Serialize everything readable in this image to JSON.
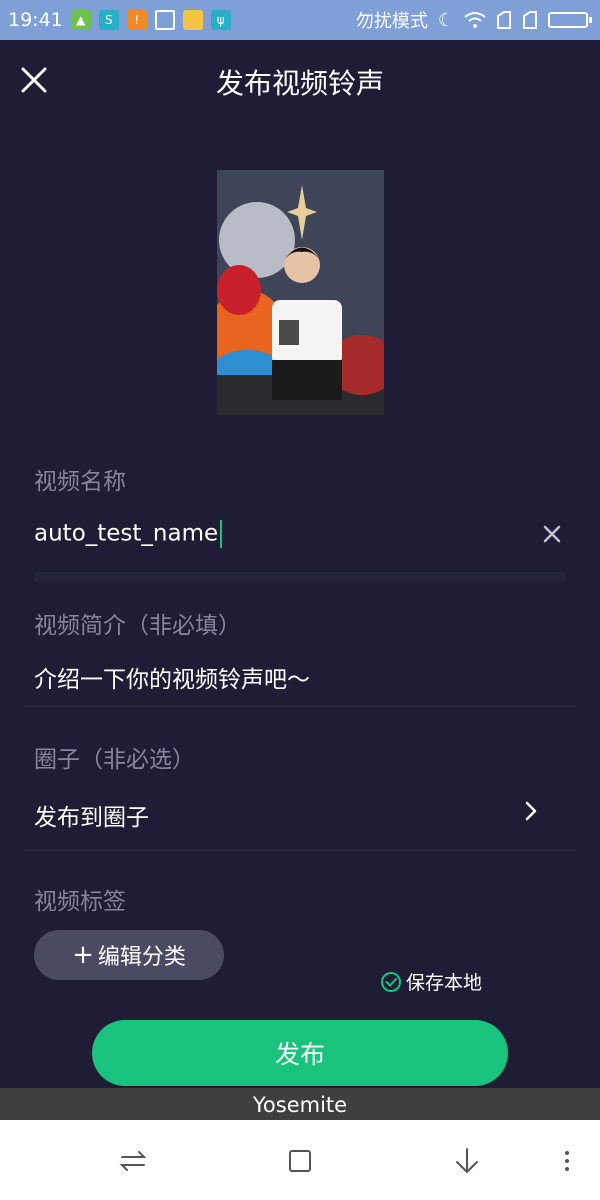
{
  "status_bar": {
    "time": "19:41",
    "right_text": "勿扰模式",
    "icons": [
      "android-icon",
      "app-icon",
      "warning-icon",
      "cleaner-icon",
      "folder-icon",
      "usb-icon",
      "moon-icon",
      "wifi-icon",
      "signal-icon",
      "signal-icon",
      "battery-icon"
    ]
  },
  "header": {
    "title": "发布视频铃声",
    "close_icon": "close-icon"
  },
  "form": {
    "name": {
      "label": "视频名称",
      "value": "auto_test_name"
    },
    "intro": {
      "label": "视频简介（非必填）",
      "placeholder": "介绍一下你的视频铃声吧～"
    },
    "circle": {
      "label": "圈子（非必选）",
      "value": "发布到圈子"
    },
    "tags": {
      "label": "视频标签",
      "edit_button": "编辑分类"
    }
  },
  "save_local": {
    "label": "保存本地",
    "checked": true
  },
  "publish_button": "发布",
  "toast": "Yosemite",
  "nav_bar": {
    "icons": [
      "switch-icon",
      "home-icon",
      "back-icon",
      "menu-icon"
    ]
  },
  "colors": {
    "background": "#1e1d35",
    "accent": "#19c37d",
    "status_bar": "#7fa0d6"
  }
}
